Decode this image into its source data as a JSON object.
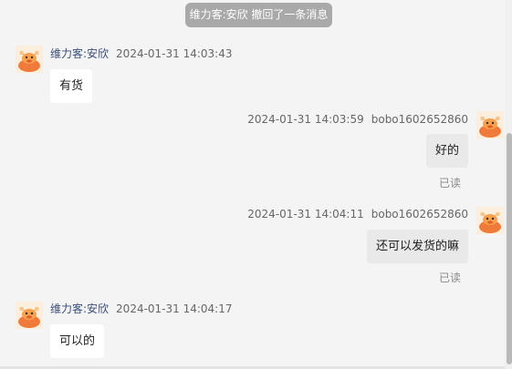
{
  "recall_notice": "维力客:安欣 撤回了一条消息",
  "messages": [
    {
      "sender": "维力客:安欣",
      "time": "2024-01-31 14:03:43",
      "text": "有货"
    },
    {
      "sender": "bobo1602652860",
      "time": "2024-01-31 14:03:59",
      "text": "好的",
      "status": "已读"
    },
    {
      "sender": "bobo1602652860",
      "time": "2024-01-31 14:04:11",
      "text": "还可以发货的嘛",
      "status": "已读"
    },
    {
      "sender": "维力客:安欣",
      "time": "2024-01-31 14:04:17",
      "text": "可以的"
    }
  ],
  "icons": {
    "avatar": "bull-mascot-icon"
  },
  "colors": {
    "background": "#f4f4f4",
    "notice_bg": "#a9a9a9",
    "sender_name": "#3a4e7a",
    "avatar_orange": "#f07a3a"
  }
}
